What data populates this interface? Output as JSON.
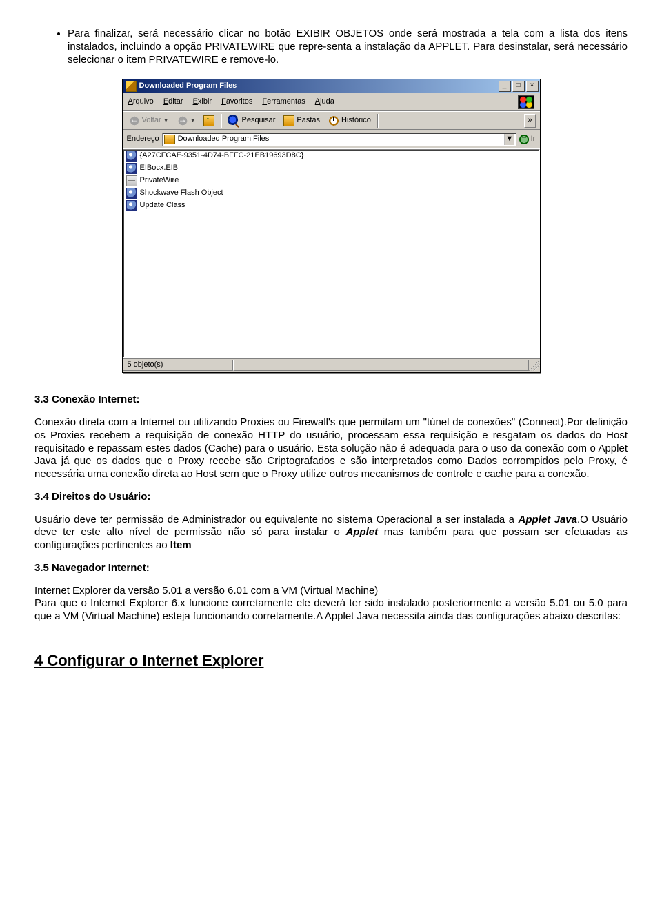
{
  "bullet": {
    "text": "Para finalizar, será necessário clicar no botão EXIBIR OBJETOS onde será mostrada a tela com a lista dos itens instalados, incluindo a opção PRIVATEWIRE que repre-senta a instalação da APPLET. Para desinstalar, será necessário selecionar o item PRIVATEWIRE e remove-lo."
  },
  "window": {
    "title": "Downloaded Program Files",
    "menus": {
      "file": "Arquivo",
      "edit": "Editar",
      "view": "Exibir",
      "fav": "Favoritos",
      "tools": "Ferramentas",
      "help": "Ajuda"
    },
    "toolbar": {
      "back": "Voltar",
      "search": "Pesquisar",
      "folders": "Pastas",
      "history": "Histórico"
    },
    "address_label": "Endereço",
    "address_value": "Downloaded Program Files",
    "go": "Ir",
    "items": [
      "{A27CFCAE-9351-4D74-BFFC-21EB19693D8C}",
      "EIBocx.EIB",
      "PrivateWire",
      "Shockwave Flash Object",
      "Update Class"
    ],
    "status": "5 objeto(s)"
  },
  "s33": {
    "heading": "3.3 Conexão Internet:",
    "body": "Conexão direta com a Internet ou utilizando Proxies ou Firewall's que permitam um \"túnel de conexões\" (Connect).Por definição os Proxies recebem a requisição de conexão HTTP do usuário, processam essa requisição e resgatam os dados do Host requisitado e repassam estes dados (Cache) para o usuário. Esta solução não é adequada para o uso da conexão com o Applet Java já que os dados que o Proxy recebe são Criptografados e são interpretados como Dados corrompidos pelo Proxy, é necessária uma conexão direta ao Host sem que o Proxy utilize outros mecanismos de controle e cache para a conexão."
  },
  "s34": {
    "heading": "3.4 Direitos do Usuário:",
    "body_pre": "Usuário deve ter permissão de Administrador ou equivalente no sistema Operacional a ser instalada a ",
    "applet_java": "Applet Java",
    "body_mid": ".O Usuário deve ter este alto nível de permissão não só para instalar o ",
    "applet": "Applet",
    "body_post": " mas também para que possam ser efetuadas as configurações pertinentes ao ",
    "item": "Item"
  },
  "s35": {
    "heading": "3.5 Navegador Internet:",
    "line1": "Internet Explorer da versão 5.01 a versão 6.01 com a VM (Virtual Machine)",
    "line2": "Para que o Internet Explorer 6.x funcione corretamente ele deverá ter sido instalado posteriormente a versão 5.01 ou 5.0 para que a VM (Virtual Machine) esteja funcionando corretamente.A Applet Java necessita ainda das configurações abaixo descritas:"
  },
  "section4": "4 Configurar o Internet Explorer"
}
